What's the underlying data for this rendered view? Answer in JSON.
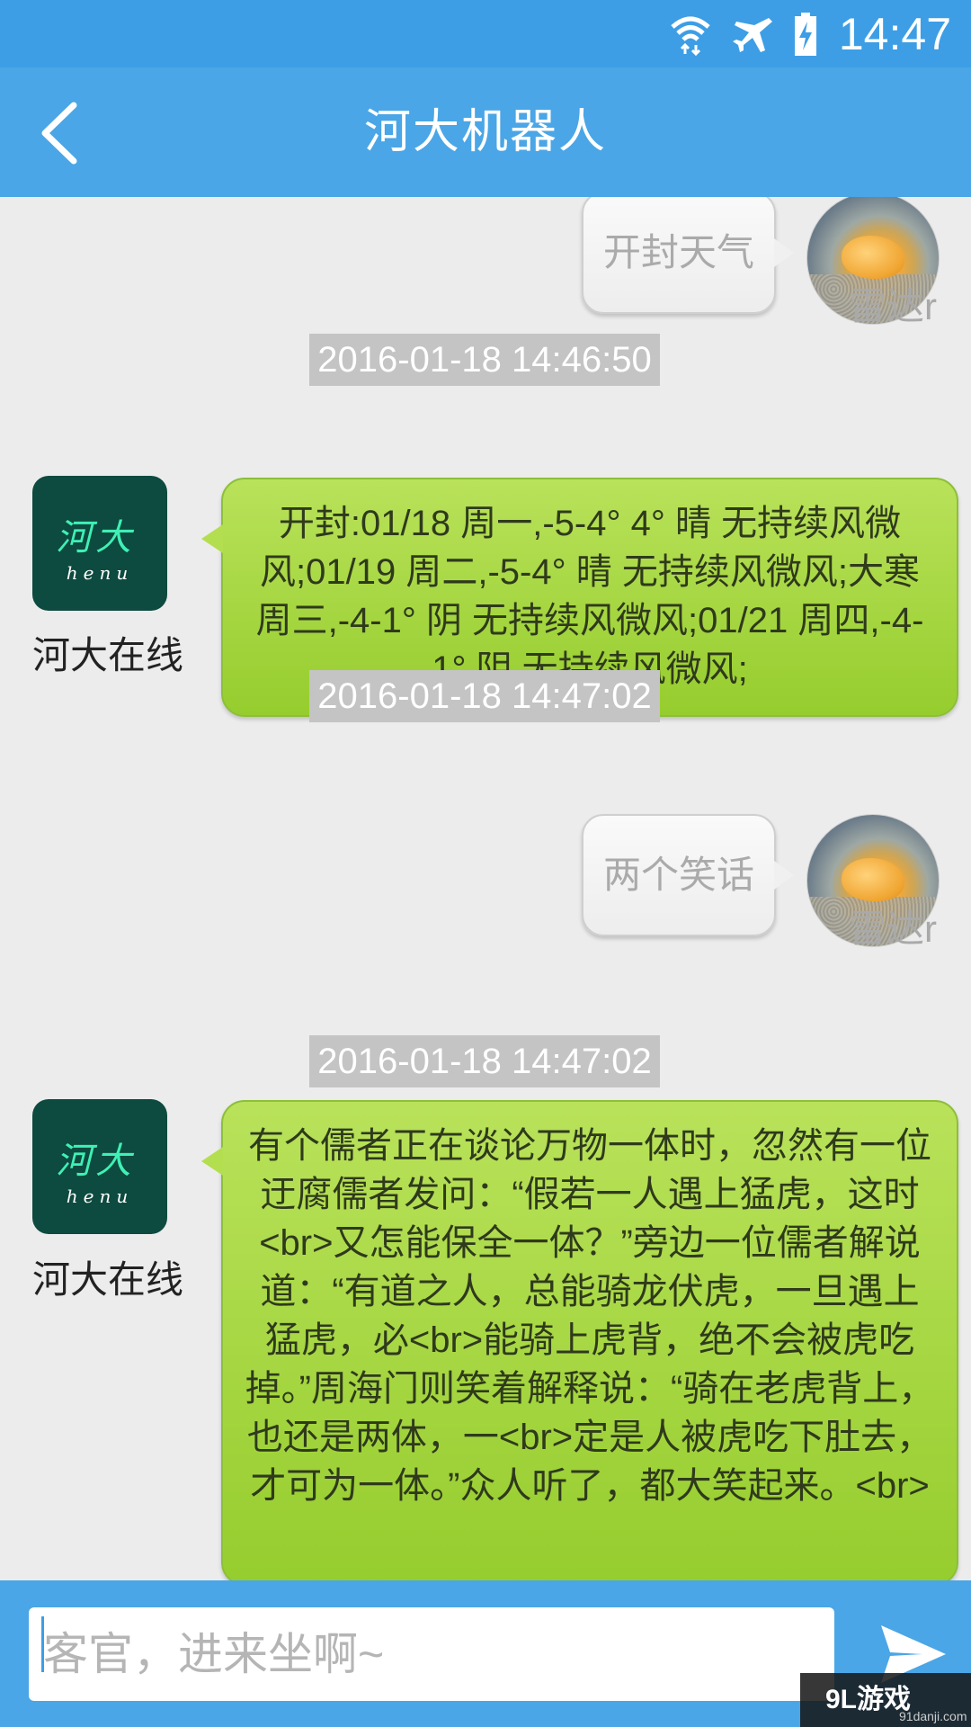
{
  "status_bar": {
    "time": "14:47",
    "icons": [
      "wifi-icon",
      "airplane-mode-icon",
      "battery-charging-icon"
    ]
  },
  "app_bar": {
    "title": "河大机器人",
    "back_icon": "chevron-left-icon"
  },
  "messages": [
    {
      "type": "outgoing",
      "text": "开封天气",
      "sender": "雷达r"
    },
    {
      "type": "timestamp",
      "text": "2016-01-18 14:46:50"
    },
    {
      "type": "incoming",
      "sender": "河大在线",
      "text": "开封:01/18 周一,-5-4° 4° 晴 无持续风微风;01/19 周二,-5-4° 晴 无持续风微风;大寒 周三,-4-1° 阴 无持续风微风;01/21 周四,-4-1° 阴 无持续风微风;"
    },
    {
      "type": "timestamp",
      "text": "2016-01-18 14:47:02"
    },
    {
      "type": "outgoing",
      "text": "两个笑话",
      "sender": "雷达r"
    },
    {
      "type": "timestamp",
      "text": "2016-01-18 14:47:02"
    },
    {
      "type": "incoming",
      "sender": "河大在线",
      "text": "有个儒者正在谈论万物一体时，忽然有一位迂腐儒者发问：“假若一人遇上猛虎，这时<br>又怎能保全一体？”旁边一位儒者解说道：“有道之人，总能骑龙伏虎，一旦遇上猛虎，必<br>能骑上虎背，绝不会被虎吃掉。”周海门则笑着解释说：“骑在老虎背上，也还是两体，一<br>定是人被虎吃下肚去，才可为一体。”众人听了，都大笑起来。<br>"
    }
  ],
  "bot_avatar": {
    "logo_text": "河大",
    "logo_sub": "henu"
  },
  "input": {
    "placeholder": "客官，进来坐啊~"
  },
  "send_icon": "send-icon",
  "watermark": {
    "main": "9L游戏",
    "sub": "91danji.com"
  },
  "colors": {
    "primary": "#4aa6e6",
    "status_bar": "#3d9ee5",
    "incoming_bubble": "#a8d846",
    "timestamp_bg": "#c4c4c4"
  }
}
